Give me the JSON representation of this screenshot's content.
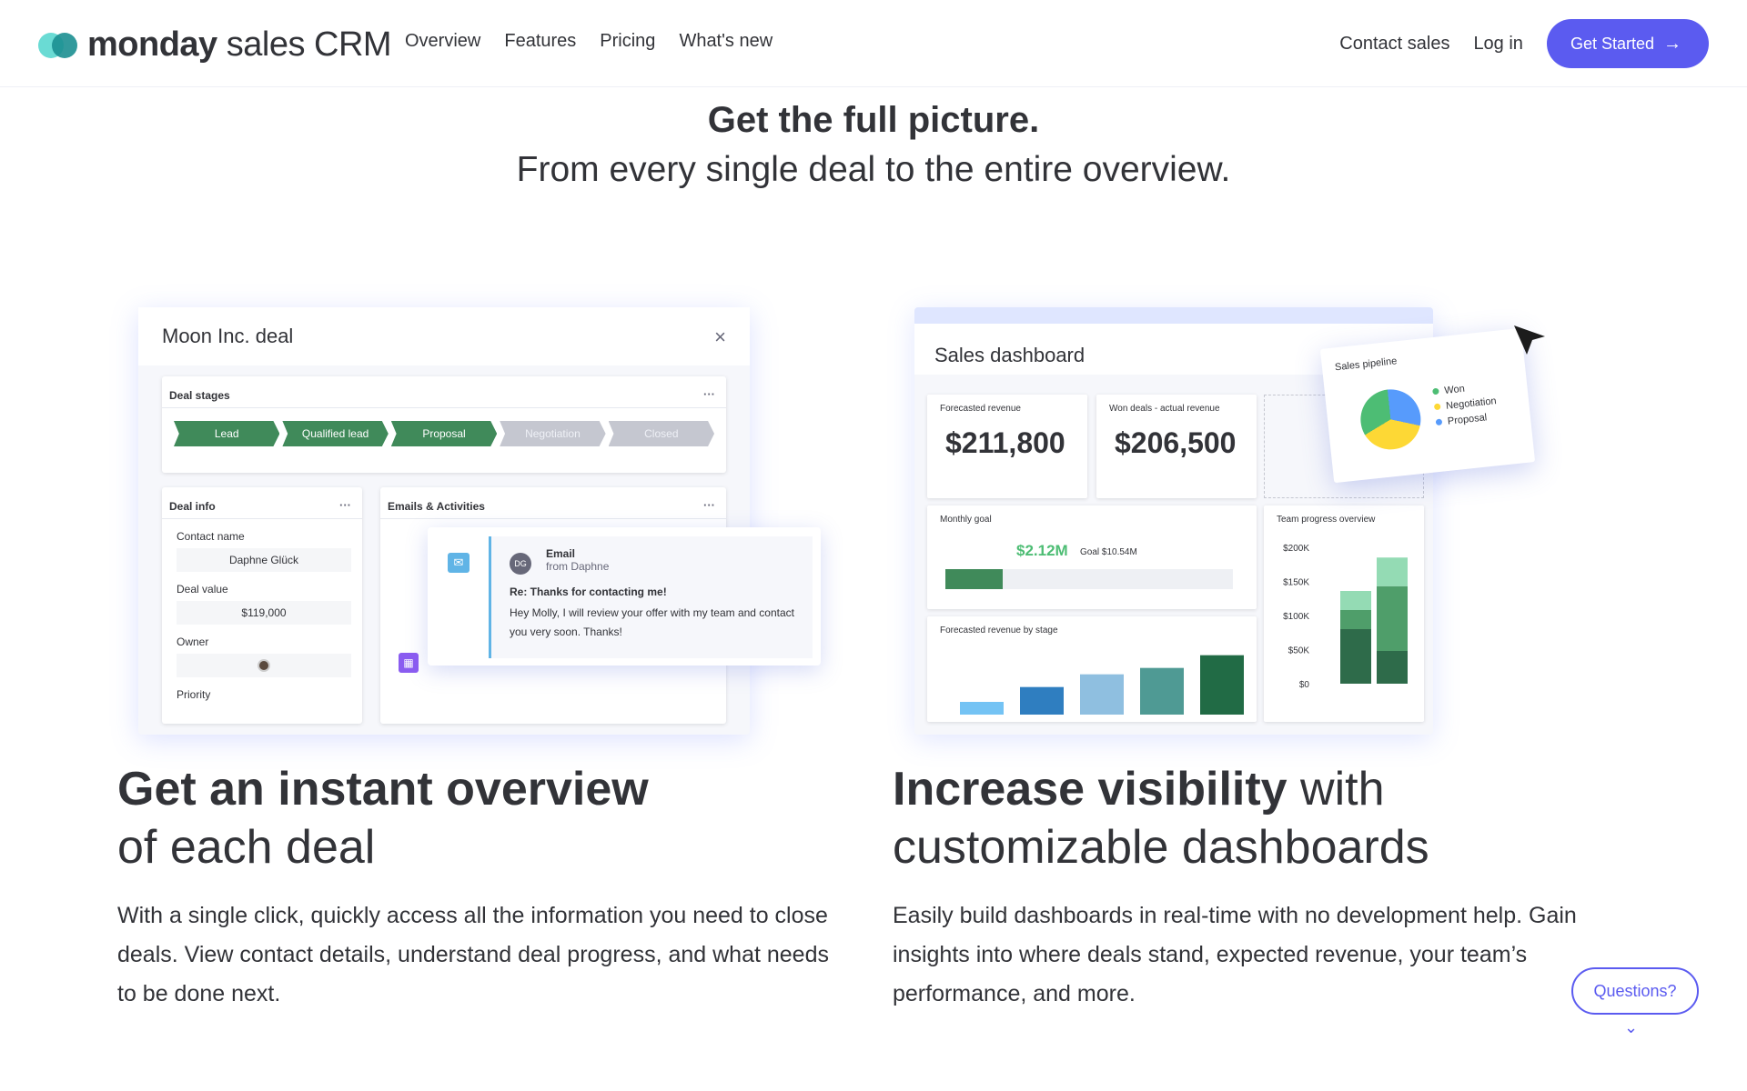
{
  "nav": {
    "logo_bold": "monday",
    "logo_light": " sales CRM",
    "links": [
      "Overview",
      "Features",
      "Pricing",
      "What's new"
    ],
    "contact": "Contact sales",
    "login": "Log in",
    "cta": "Get Started",
    "cta_arrow": "→"
  },
  "hero": {
    "title": "Get the full picture.",
    "subtitle": "From every single deal to the entire overview."
  },
  "deal": {
    "title": "Moon Inc. deal",
    "close": "×",
    "stages_title": "Deal stages",
    "stages": [
      "Lead",
      "Qualified lead",
      "Proposal",
      "Negotiation",
      "Closed"
    ],
    "info_title": "Deal info",
    "contact_label": "Contact name",
    "contact_value": "Daphne Glück",
    "value_label": "Deal value",
    "value_value": "$119,000",
    "owner_label": "Owner",
    "priority_label": "Priority",
    "emails_title": "Emails & Activities",
    "email": {
      "avatar": "DG",
      "type": "Email",
      "from": "from Daphne",
      "subject": "Re: Thanks for contacting me!",
      "body": "Hey Molly, I will review your offer with my team and contact you very soon. Thanks!"
    },
    "dots": "···"
  },
  "dashboard": {
    "title": "Sales dashboard",
    "forecast_label": "Forecasted revenue",
    "forecast_value": "$211,800",
    "won_label": "Won deals - actual revenue",
    "won_value": "$206,500",
    "goal_label": "Monthly goal",
    "goal_value": "$2.12M",
    "goal_total": "Goal $10.54M",
    "goal_progress": 0.2,
    "stage_label": "Forecasted revenue by stage",
    "team_label": "Team progress overview",
    "pipeline_title": "Sales pipeline",
    "pipeline_legend": [
      "Won",
      "Negotiation",
      "Proposal"
    ],
    "colors": {
      "won": "#4dbd74",
      "negotiation": "#fdd835",
      "proposal": "#579bfc"
    }
  },
  "chart_data": [
    {
      "type": "bar",
      "title": "Forecasted revenue by stage",
      "categories": [
        "",
        "",
        "",
        "",
        ""
      ],
      "values": [
        12,
        26,
        38,
        44,
        56
      ],
      "colors": [
        "#74c3f4",
        "#2f7ec0",
        "#8fbfe0",
        "#4f9a94",
        "#216b45"
      ],
      "ylim": [
        0,
        60
      ]
    },
    {
      "type": "bar",
      "title": "Team progress overview",
      "stacked": true,
      "categories": [
        "",
        ""
      ],
      "y_ticks": [
        "$0",
        "$50K",
        "$100K",
        "$150K",
        "$200K"
      ],
      "series": [
        {
          "values": [
            80,
            48
          ],
          "color": "#2e6b4a"
        },
        {
          "values": [
            28,
            95
          ],
          "color": "#4f9e6a"
        },
        {
          "values": [
            28,
            42
          ],
          "color": "#94dbb4"
        }
      ],
      "ylim": [
        0,
        200
      ]
    }
  ],
  "features": {
    "left_title_bold": "Get an instant overview",
    "left_title_light": "of each deal",
    "left_desc": "With a single click, quickly access all the information you need to close deals. View contact details, understand deal progress, and what needs to be done next.",
    "right_title_bold": "Increase visibility",
    "right_title_light_1": " with",
    "right_title_light_2": "customizable dashboards",
    "right_desc": "Easily build dashboards in real-time with no development help. Gain insights into where deals stand, expected revenue, your team’s performance, and more."
  },
  "widget": {
    "questions": "Questions?",
    "chevron": "⌄"
  }
}
